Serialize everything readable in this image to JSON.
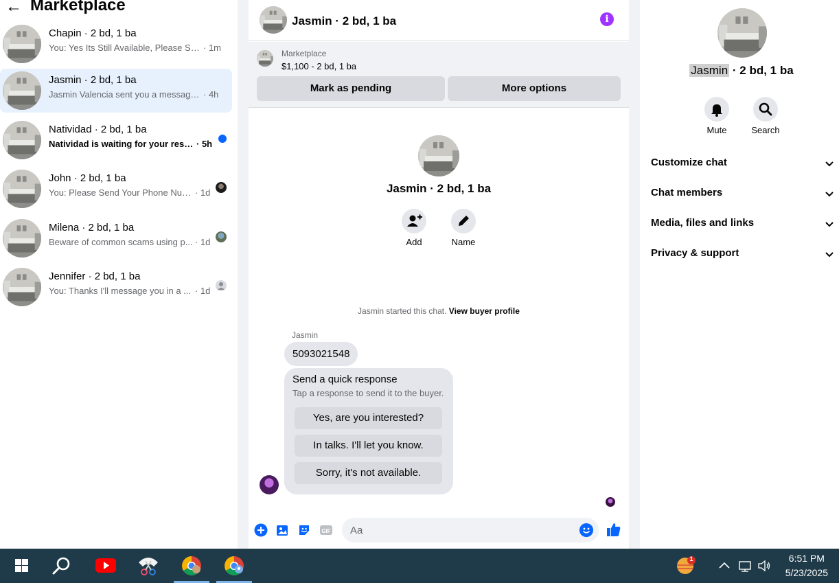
{
  "sidebar": {
    "title": "Marketplace",
    "conversations": [
      {
        "title": "Chapin · 2 bd, 1 ba",
        "snippet": "You: Yes Its Still Available, Please Sen...",
        "time": "· 1m",
        "indicator": "none"
      },
      {
        "title": "Jasmin · 2 bd, 1 ba",
        "snippet": "Jasmin Valencia sent you a message a...",
        "time": "· 4h",
        "indicator": "none",
        "active": true
      },
      {
        "title": "Natividad · 2 bd, 1 ba",
        "snippet": "Natividad is waiting for your respo...",
        "time": "· 5h",
        "indicator": "unread-dot"
      },
      {
        "title": "John · 2 bd, 1 ba",
        "snippet": "You: Please Send Your Phone Num...",
        "time": "· 1d",
        "indicator": "seen-avatar"
      },
      {
        "title": "Milena · 2 bd, 1 ba",
        "snippet": "Beware of common scams using p...",
        "time": "· 1d",
        "indicator": "seen-avatar"
      },
      {
        "title": "Jennifer · 2 bd, 1 ba",
        "snippet": "You: Thanks I'll message you in a ...",
        "time": "· 1d",
        "indicator": "default-avatar"
      }
    ]
  },
  "chat": {
    "header_title": "Jasmin · 2 bd, 1 ba",
    "listing": {
      "label": "Marketplace",
      "price_line": "$1,100 - 2 bd, 1 ba",
      "mark_pending": "Mark as pending",
      "more_options": "More options"
    },
    "profile_name": "Jasmin · 2 bd, 1 ba",
    "add_label": "Add",
    "name_label": "Name",
    "started_text": "Jasmin started this chat.",
    "view_buyer_profile": "View buyer profile",
    "sender": "Jasmin",
    "message": "5093021548",
    "quick_title": "Send a quick response",
    "quick_sub": "Tap a response to send it to the buyer.",
    "quick_responses": [
      "Yes, are you interested?",
      "In talks. I'll let you know.",
      "Sorry, it's not available."
    ],
    "input_placeholder": "Aa"
  },
  "info_panel": {
    "name_highlight": "Jasmin",
    "name_rest": " · 2 bd, 1 ba",
    "mute_label": "Mute",
    "search_label": "Search",
    "sections": [
      "Customize chat",
      "Chat members",
      "Media, files and links",
      "Privacy & support"
    ]
  },
  "taskbar": {
    "time": "6:51 PM",
    "date": "5/23/2025",
    "weather_badge": "1"
  },
  "colors": {
    "accent": "#0866ff",
    "info_purple": "#a033ff",
    "active_row": "#e7f1fd",
    "taskbar": "#1f3a48"
  }
}
